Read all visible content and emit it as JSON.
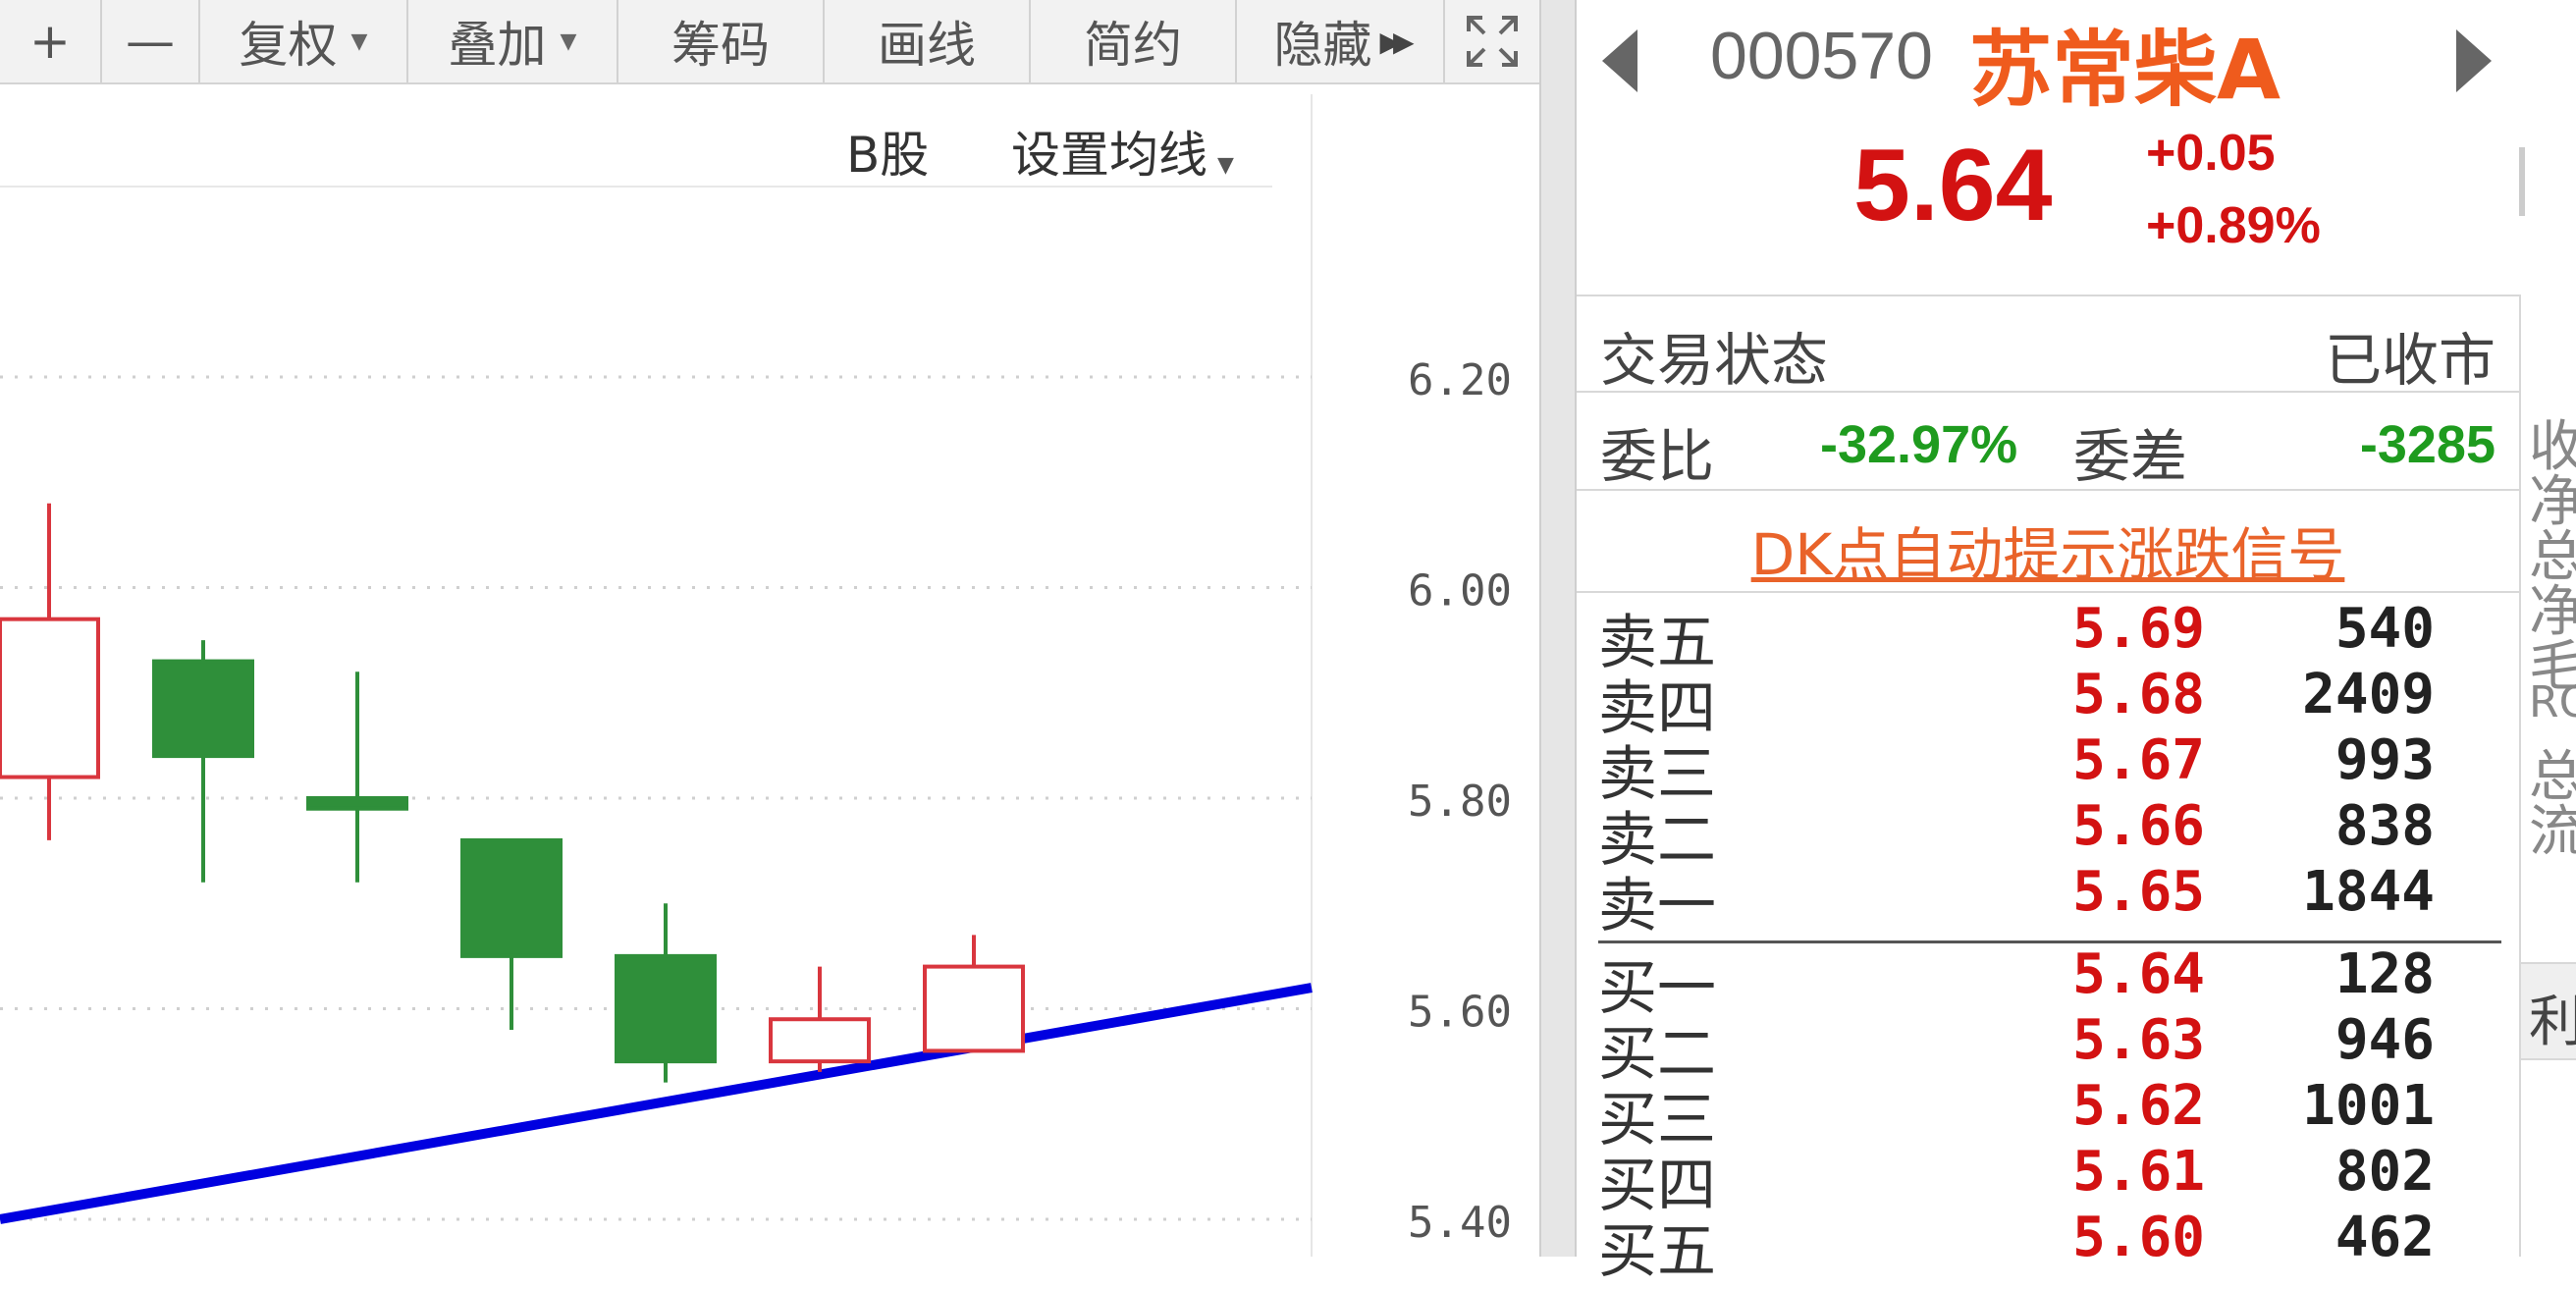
{
  "toolbar": {
    "items": [
      {
        "label": "+",
        "caret": false
      },
      {
        "label": "—",
        "caret": false
      },
      {
        "label": "复权",
        "caret": true
      },
      {
        "label": "叠加",
        "caret": true
      },
      {
        "label": "筹码",
        "caret": false
      },
      {
        "label": "画线",
        "caret": false
      },
      {
        "label": "简约",
        "caret": false
      },
      {
        "label": "隐藏",
        "caret": false,
        "double_arrow": true
      },
      {
        "label": "",
        "icon": "fullscreen-icon"
      }
    ]
  },
  "chart_header": {
    "b_share": "B股",
    "ma_setting": "设置均线"
  },
  "chart_data": {
    "type": "candlestick",
    "y_ticks": [
      "6.20",
      "6.00",
      "5.80",
      "5.60",
      "5.40"
    ],
    "ylim": [
      5.36,
      6.44
    ],
    "candles": [
      {
        "open": 5.82,
        "close": 5.97,
        "high": 6.08,
        "low": 5.76,
        "direction": "up"
      },
      {
        "open": 5.93,
        "close": 5.84,
        "high": 5.95,
        "low": 5.72,
        "direction": "down"
      },
      {
        "open": 5.8,
        "close": 5.79,
        "high": 5.92,
        "low": 5.72,
        "direction": "down"
      },
      {
        "open": 5.76,
        "close": 5.65,
        "high": 5.76,
        "low": 5.58,
        "direction": "down"
      },
      {
        "open": 5.65,
        "close": 5.55,
        "high": 5.7,
        "low": 5.53,
        "direction": "down"
      },
      {
        "open": 5.55,
        "close": 5.59,
        "high": 5.64,
        "low": 5.54,
        "direction": "up"
      },
      {
        "open": 5.56,
        "close": 5.64,
        "high": 5.67,
        "low": 5.56,
        "direction": "up"
      }
    ],
    "trendline": {
      "start": 5.4,
      "end": 5.62,
      "color": "#0000e0"
    },
    "colors": {
      "up": "#d9363e",
      "down": "#2f8f3a",
      "grid": "#cfcfcf"
    }
  },
  "quote": {
    "code": "000570",
    "name": "苏常柴A",
    "price": "5.64",
    "change": "+0.05",
    "change_pct": "+0.89%",
    "status_label": "交易状态",
    "status_value": "已收市",
    "ratio_label": "委比",
    "ratio_value": "-32.97%",
    "diff_label": "委差",
    "diff_value": "-3285",
    "signal_link": "DK点自动提示涨跌信号"
  },
  "order_book": {
    "asks": [
      {
        "label": "卖五",
        "price": "5.69",
        "volume": "540"
      },
      {
        "label": "卖四",
        "price": "5.68",
        "volume": "2409"
      },
      {
        "label": "卖三",
        "price": "5.67",
        "volume": "993"
      },
      {
        "label": "卖二",
        "price": "5.66",
        "volume": "838"
      },
      {
        "label": "卖一",
        "price": "5.65",
        "volume": "1844"
      }
    ],
    "bids": [
      {
        "label": "买一",
        "price": "5.64",
        "volume": "128"
      },
      {
        "label": "买二",
        "price": "5.63",
        "volume": "946"
      },
      {
        "label": "买三",
        "price": "5.62",
        "volume": "1001"
      },
      {
        "label": "买四",
        "price": "5.61",
        "volume": "802"
      },
      {
        "label": "买五",
        "price": "5.60",
        "volume": "462"
      }
    ]
  },
  "side_strip": {
    "chars": [
      "收",
      "净",
      "总",
      "净",
      "毛",
      "RO",
      "总",
      "流"
    ],
    "tab": "利"
  }
}
